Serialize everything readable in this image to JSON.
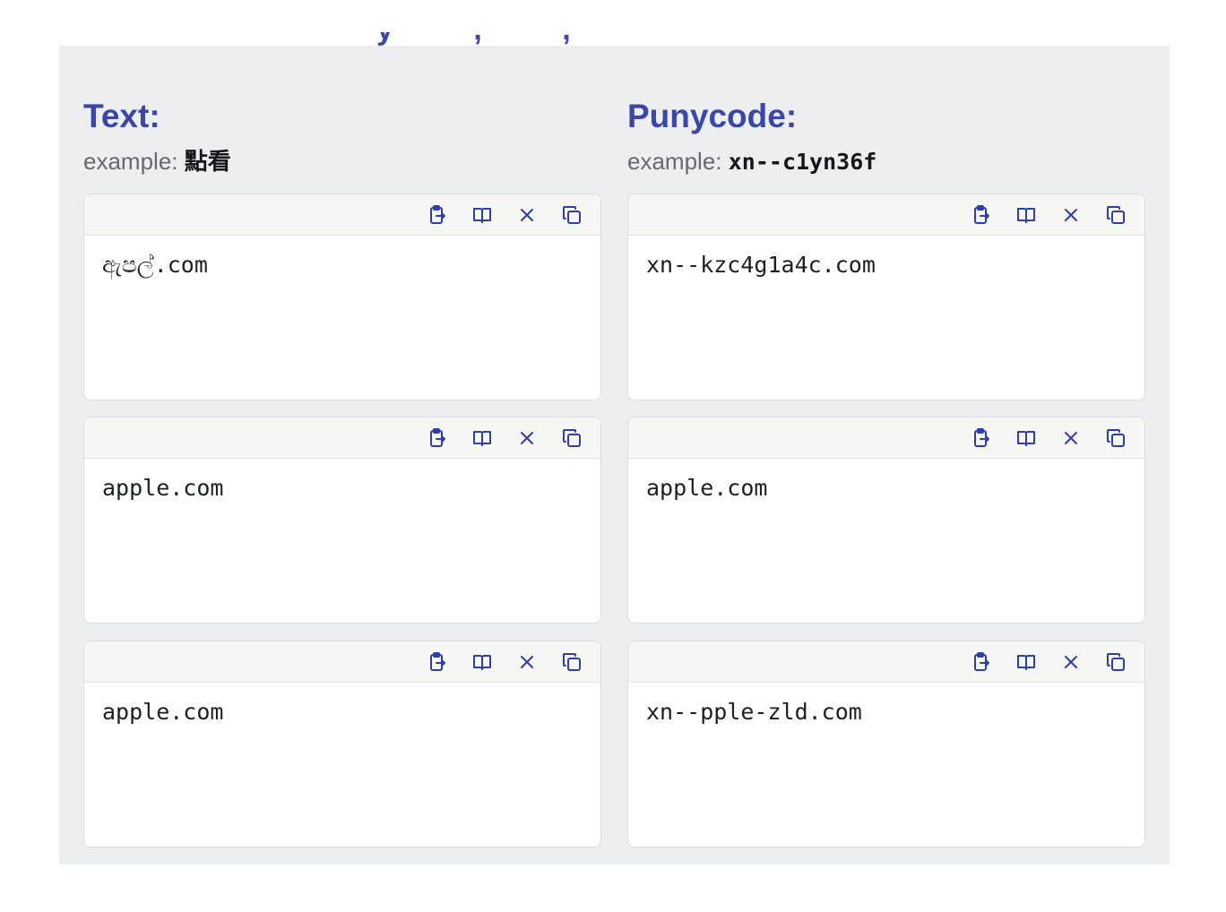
{
  "text_column": {
    "heading": "Text:",
    "example_label": "example:",
    "example_value": "點看"
  },
  "punycode_column": {
    "heading": "Punycode:",
    "example_label": "example:",
    "example_value": "xn--c1yn36f"
  },
  "rows": [
    {
      "text": "ඇපල්.com",
      "punycode": "xn--kzc4g1a4c.com"
    },
    {
      "text": "apple.com",
      "punycode": "apple.com"
    },
    {
      "text": "аpple.com",
      "punycode": "xn--pple-zld.com"
    }
  ],
  "icons": [
    "paste-icon",
    "book-icon",
    "clear-icon",
    "copy-icon"
  ]
}
